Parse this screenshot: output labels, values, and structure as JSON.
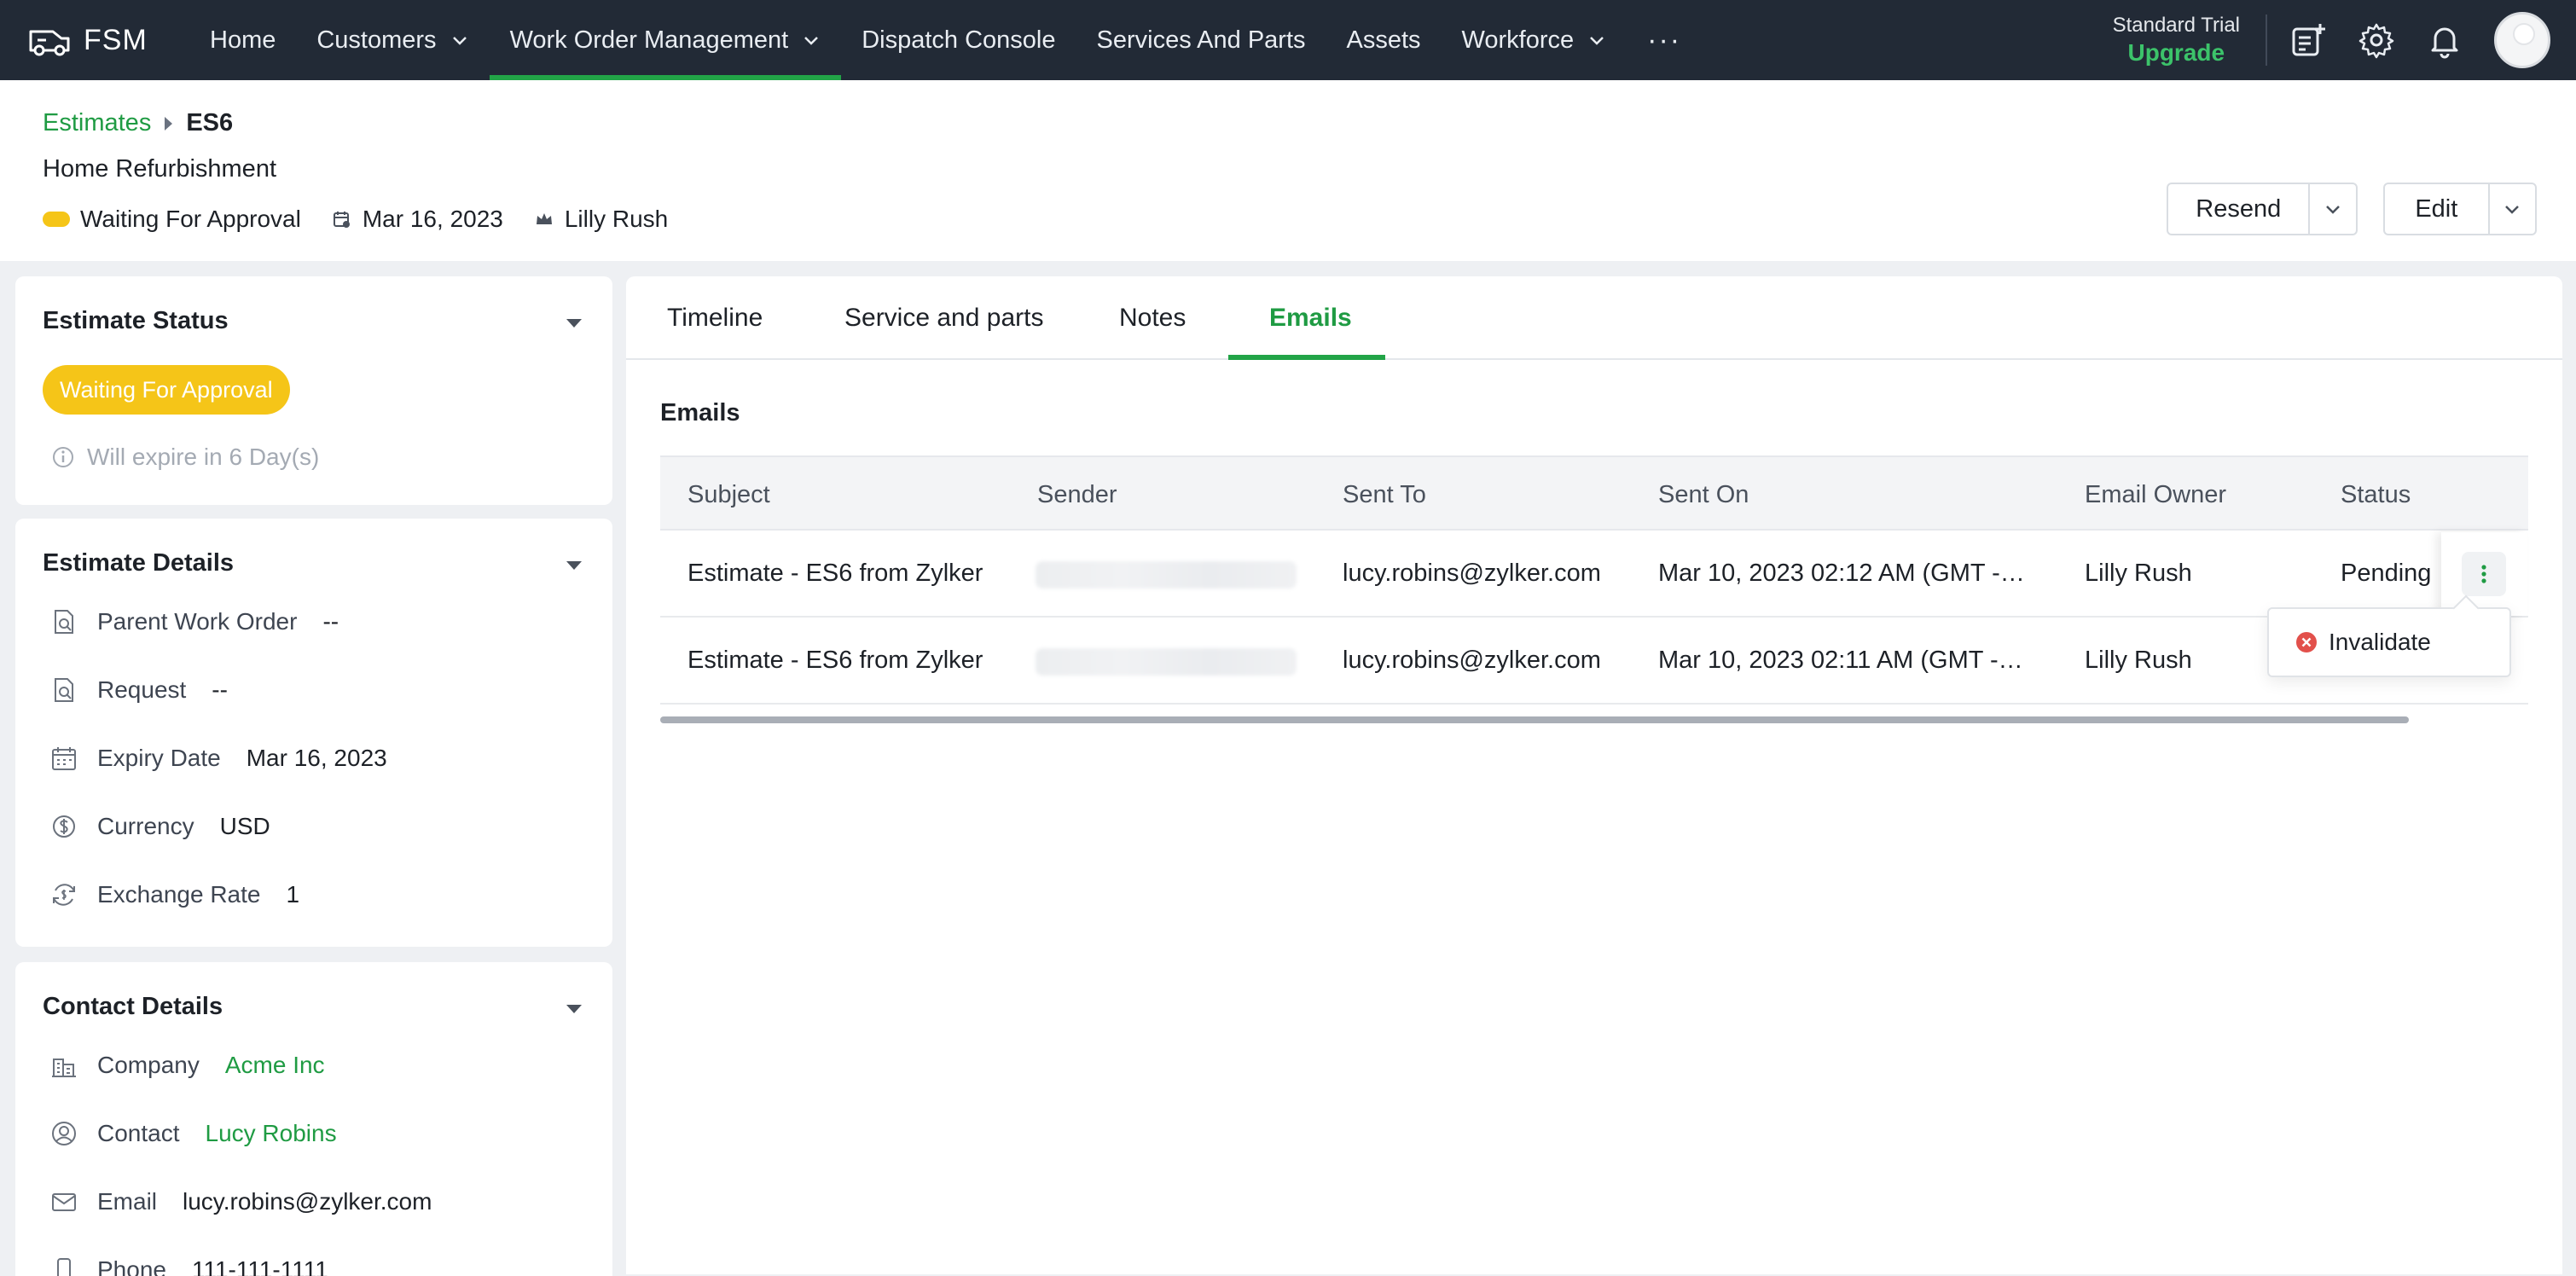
{
  "app": {
    "name": "FSM"
  },
  "nav": {
    "items": [
      {
        "label": "Home"
      },
      {
        "label": "Customers"
      },
      {
        "label": "Work Order Management"
      },
      {
        "label": "Dispatch Console"
      },
      {
        "label": "Services And Parts"
      },
      {
        "label": "Assets"
      },
      {
        "label": "Workforce"
      }
    ],
    "more": "···",
    "active": "Work Order Management",
    "trial": {
      "label": "Standard Trial",
      "upgrade": "Upgrade"
    }
  },
  "header": {
    "breadcrumb": {
      "parent": "Estimates",
      "current": "ES6"
    },
    "title": "Home Refurbishment",
    "status": "Waiting For Approval",
    "date": "Mar 16, 2023",
    "owner": "Lilly Rush",
    "resend_label": "Resend",
    "edit_label": "Edit"
  },
  "estimate_status": {
    "title": "Estimate Status",
    "status": "Waiting For Approval",
    "expiry_note": "Will expire in 6 Day(s)"
  },
  "estimate_details": {
    "title": "Estimate Details",
    "fields": [
      {
        "label": "Parent Work Order",
        "value": "--",
        "icon": "document-search-icon"
      },
      {
        "label": "Request",
        "value": "--",
        "icon": "document-search-icon"
      },
      {
        "label": "Expiry Date",
        "value": "Mar 16, 2023",
        "icon": "calendar-icon"
      },
      {
        "label": "Currency",
        "value": "USD",
        "icon": "dollar-circle-icon"
      },
      {
        "label": "Exchange Rate",
        "value": "1",
        "icon": "exchange-icon"
      }
    ]
  },
  "contact_details": {
    "title": "Contact Details",
    "fields": [
      {
        "label": "Company",
        "value": "Acme Inc",
        "icon": "building-icon"
      },
      {
        "label": "Contact",
        "value": "Lucy Robins",
        "icon": "person-icon"
      },
      {
        "label": "Email",
        "value": "lucy.robins@zylker.com",
        "icon": "envelope-icon"
      },
      {
        "label": "Phone",
        "value": "111-111-1111",
        "icon": "phone-icon"
      }
    ]
  },
  "tabs": [
    {
      "label": "Timeline"
    },
    {
      "label": "Service and parts"
    },
    {
      "label": "Notes"
    },
    {
      "label": "Emails"
    }
  ],
  "active_tab": "Emails",
  "emails": {
    "title": "Emails",
    "columns": [
      "Subject",
      "Sender",
      "Sent To",
      "Sent On",
      "Email Owner",
      "Status"
    ],
    "rows": [
      {
        "subject": "Estimate - ES6 from Zylker",
        "sent_to": "lucy.robins@zylker.com",
        "sent_on": "Mar 10, 2023 02:12 AM (GMT -…",
        "owner": "Lilly Rush",
        "status": "Pending"
      },
      {
        "subject": "Estimate - ES6 from Zylker",
        "sent_to": "lucy.robins@zylker.com",
        "sent_on": "Mar 10, 2023 02:11 AM (GMT -…",
        "owner": "Lilly Rush",
        "status": ""
      }
    ],
    "menu": {
      "invalidate_label": "Invalidate"
    }
  },
  "colors": {
    "accent": "#22a447",
    "nav_bg": "#222a36",
    "status_yellow": "#f5c518"
  }
}
